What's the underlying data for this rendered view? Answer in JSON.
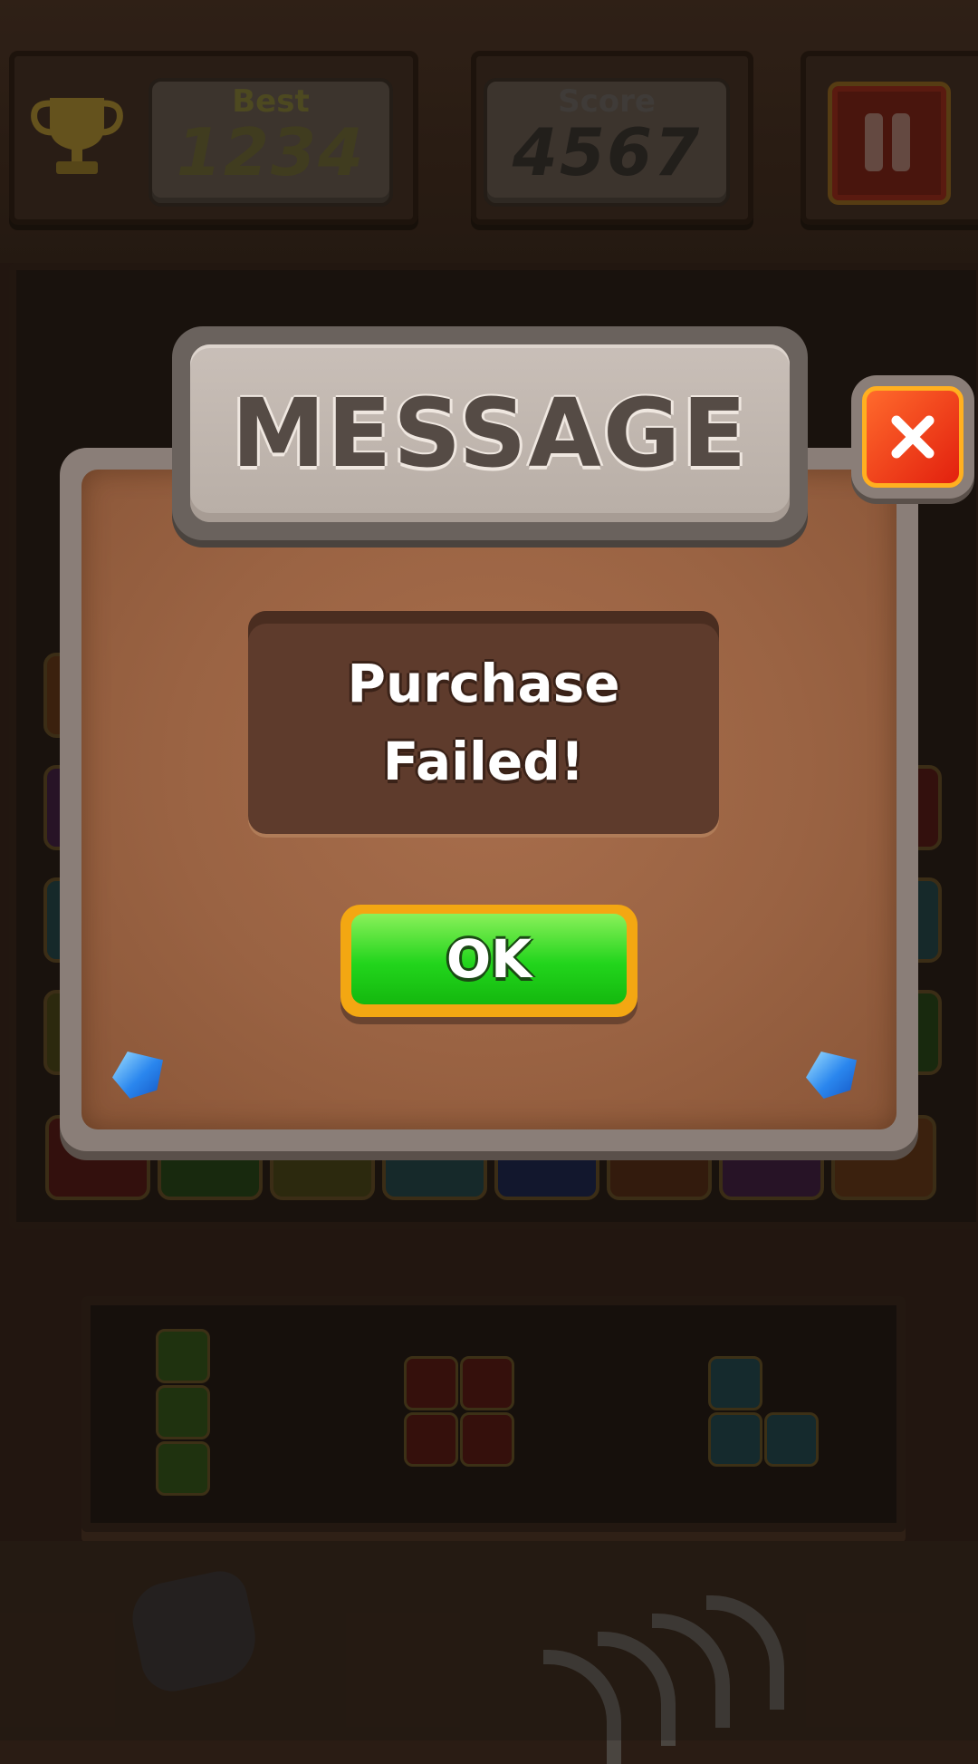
{
  "hud": {
    "best_label": "Best",
    "best_value": "1234",
    "score_label": "Score",
    "score_value": "4567"
  },
  "icons": {
    "trophy": "trophy-icon",
    "pause": "pause-icon",
    "close": "close-icon",
    "gem": "gem-icon"
  },
  "dialog": {
    "title": "MESSAGE",
    "message_line1": "Purchase",
    "message_line2": "Failed!",
    "ok_label": "OK"
  },
  "colors": {
    "ok_green": "#22d51c",
    "ok_border": "#f3a712",
    "close_red": "#e2200e",
    "dialog_brown": "#9a6343"
  }
}
